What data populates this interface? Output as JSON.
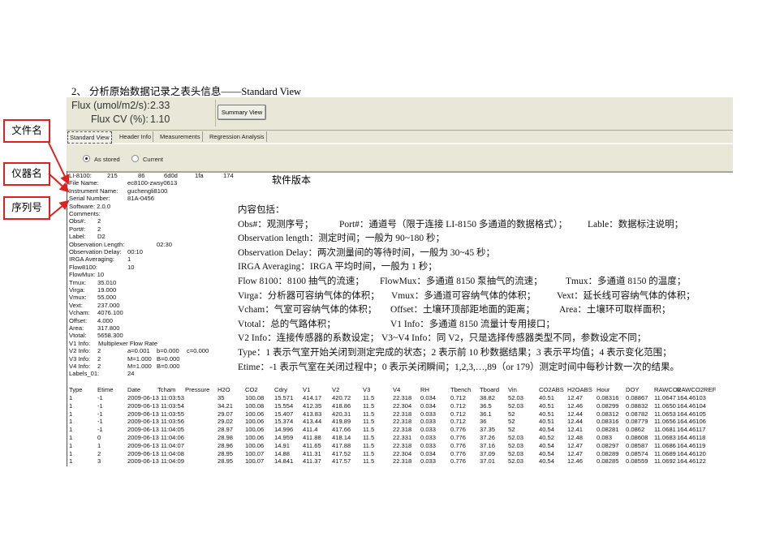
{
  "doc_title": "2、 分析原始数据记录之表头信息——Standard View",
  "callouts": [
    "文件名",
    "仪器名",
    "序列号"
  ],
  "software_version_note": "软件版本",
  "app": {
    "flux_label": "Flux (umol/m2/s):",
    "flux_value": "2.33",
    "flux_cv_label": "Flux CV (%):",
    "flux_cv_value": "1.10",
    "summary_button": "Summary View",
    "tabs": [
      "Standard View",
      "Header Info",
      "Measurements",
      "Regression Analysis"
    ],
    "active_tab": "Standard View",
    "radios": [
      {
        "label": "As stored",
        "checked": true
      },
      {
        "label": "Current",
        "checked": false
      }
    ],
    "header_lines": [
      [
        "LI-8100:",
        "215",
        "86",
        "6d0d",
        "1fa",
        "174"
      ],
      [
        "File Name:",
        "ec8100-zwsy0613"
      ],
      [
        "Instrument Name:",
        "guchengli8100"
      ],
      [
        "Serial Number:",
        "81A-0456"
      ],
      [
        "Software: 2.0.0"
      ],
      [
        "Comments:"
      ],
      [
        "Obs#:",
        "2"
      ],
      [
        "Port#:",
        "2"
      ],
      [
        "Label:",
        "D2"
      ],
      [
        "Observation Length:",
        "02:30"
      ],
      [
        "Observation Delay:",
        "00:10"
      ],
      [
        "IRGA Averaging:",
        "1"
      ],
      [
        "Flow8100:",
        "10"
      ],
      [
        "FlowMux: 10"
      ],
      [
        "Tmux:",
        "35.010"
      ],
      [
        "Virga:",
        "19.000"
      ],
      [
        "Vmux:",
        "55.000"
      ],
      [
        "Vext:",
        "237.000"
      ],
      [
        "Vcham:",
        "4076.100"
      ],
      [
        "Offset:",
        "4.000"
      ],
      [
        "Area:",
        "317.800"
      ],
      [
        "Vtotal:",
        "5658.300"
      ],
      [
        "V1 Info:",
        "Multiplexer Flow Rate"
      ],
      [
        "V2 Info:",
        "2",
        "a=0.001",
        "b=0.000",
        "c=0.000"
      ],
      [
        "V3 Info:",
        "2",
        "M=1.000",
        "B=0.000"
      ],
      [
        "V4 Info:",
        "2",
        "M=1.000",
        "B=0.000"
      ],
      [
        "Labels_01:",
        "24"
      ]
    ],
    "table": {
      "columns": [
        "Type",
        "Etime",
        "Date",
        "Tcham",
        "Pressure",
        "H2O",
        "CO2",
        "Cdry",
        "V1",
        "V2",
        "V3",
        "V4",
        "RH",
        "Tbench",
        "Tboard",
        "Vin",
        "CO2ABS",
        "H2OABS",
        "Hour",
        "DOY",
        "RAWCO2",
        "RAWCO2REF"
      ],
      "rows": [
        [
          "1",
          "-1",
          "2009-06-13 11:03:53",
          "",
          "",
          "35",
          "100.08",
          "15.571",
          "414.17",
          "420.72",
          "11.5",
          "22.318",
          "0.034",
          "0.712",
          "38.82",
          "52.03",
          "40.51",
          "12.47",
          "0.08316",
          "0.08867",
          "11.0647",
          "164.46103"
        ],
        [
          "1",
          "-1",
          "2009-06-13 11:03:54",
          "",
          "",
          "34.21",
          "100.08",
          "15.554",
          "412.35",
          "418.86",
          "11.5",
          "22.304",
          "0.034",
          "0.712",
          "36.5",
          "52.03",
          "40.51",
          "12.46",
          "0.08299",
          "0.08832",
          "11.0650",
          "164.46104"
        ],
        [
          "1",
          "-1",
          "2009-06-13 11:03:55",
          "",
          "",
          "29.07",
          "100.06",
          "15.407",
          "413.83",
          "420.31",
          "11.5",
          "22.318",
          "0.033",
          "0.712",
          "36.1",
          "52",
          "40.51",
          "12.44",
          "0.08312",
          "0.08782",
          "11.0653",
          "164.46105"
        ],
        [
          "1",
          "-1",
          "2009-06-13 11:03:56",
          "",
          "",
          "29.02",
          "100.06",
          "15.374",
          "413.44",
          "419.89",
          "11.5",
          "22.318",
          "0.033",
          "0.712",
          "36",
          "52",
          "40.51",
          "12.44",
          "0.08316",
          "0.08779",
          "11.0656",
          "164.46106"
        ],
        [
          "1",
          "-1",
          "2009-06-13 11:04:05",
          "",
          "",
          "28.97",
          "100.06",
          "14.996",
          "411.4",
          "417.66",
          "11.5",
          "22.318",
          "0.033",
          "0.776",
          "37.35",
          "52",
          "40.54",
          "12.41",
          "0.08281",
          "0.0862",
          "11.0681",
          "164.46117"
        ],
        [
          "1",
          "0",
          "2009-06-13 11:04:06",
          "",
          "",
          "28.98",
          "100.06",
          "14.959",
          "411.88",
          "418.14",
          "11.5",
          "22.331",
          "0.033",
          "0.776",
          "37.26",
          "52.03",
          "40.52",
          "12.48",
          "0.083",
          "0.08608",
          "11.0683",
          "164.46118"
        ],
        [
          "1",
          "1",
          "2009-06-13 11:04:07",
          "",
          "",
          "28.96",
          "100.06",
          "14.91",
          "411.65",
          "417.88",
          "11.5",
          "22.318",
          "0.033",
          "0.776",
          "37.16",
          "52.03",
          "40.54",
          "12.47",
          "0.08297",
          "0.08587",
          "11.0686",
          "164.46119"
        ],
        [
          "1",
          "2",
          "2009-06-13 11:04:08",
          "",
          "",
          "28.95",
          "100.07",
          "14.88",
          "411.31",
          "417.52",
          "11.5",
          "22.304",
          "0.034",
          "0.776",
          "37.09",
          "52.03",
          "40.54",
          "12.47",
          "0.08289",
          "0.08574",
          "11.0689",
          "164.46120"
        ],
        [
          "1",
          "3",
          "2009-06-13 11:04:09",
          "",
          "",
          "28.95",
          "100.07",
          "14.841",
          "411.37",
          "417.57",
          "11.5",
          "22.318",
          "0.033",
          "0.776",
          "37.01",
          "52.03",
          "40.54",
          "12.46",
          "0.08285",
          "0.08559",
          "11.0692",
          "164.46122"
        ]
      ]
    }
  },
  "notes": [
    [
      "内容包括："
    ],
    [
      "Obs#：观测序号；",
      "Port#：通道号（限于连接 LI-8150 多通道的数据格式）；",
      "Lable：数据标注说明；"
    ],
    [
      "Observation length：测定时间；一般为 90~180 秒；"
    ],
    [
      "Observation Delay：两次测量间的等待时间，一般为 30~45 秒；"
    ],
    [
      "IRGA Averaging：IRGA  平均时间，一般为 1 秒；"
    ],
    [
      "Flow  8100：8100 抽气的流速；",
      "FlowMux：多通道 8150 泵抽气的流速；",
      "Tmux：多通道 8150 的温度；"
    ],
    [
      "Virga：分析器可容纳气体的体积；",
      "Vmux：多通道可容纳气体的体积；",
      "Vext：延长线可容纳气体的体积；"
    ],
    [
      "Vcham：气室可容纳气体的体积；",
      "Offset：土壤环顶部距地面的距离；",
      "Area：土壤环可取样面积；"
    ],
    [
      "Vtotal：总的气路体积；",
      "V1 Info：多通道 8150 流量计专用接口；"
    ],
    [
      "V2 Info：连接传感器的系数设定；  V3~V4 Info：同 V2，只是选择传感器类型不同，参数设定不同；"
    ],
    [
      "Type：1 表示气室开始关闭到测定完成的状态；2 表示前 10 秒数据结果；3 表示平均值；4 表示变化范围；"
    ],
    [
      "Etime：-1 表示气室在关闭过程中；0 表示关闭瞬间；1,2,3,…,89（or 179）测定时间中每秒计数一次的结果。"
    ]
  ],
  "colors": {
    "panel": "#e9e7d7",
    "callout_red": "#e02020"
  }
}
